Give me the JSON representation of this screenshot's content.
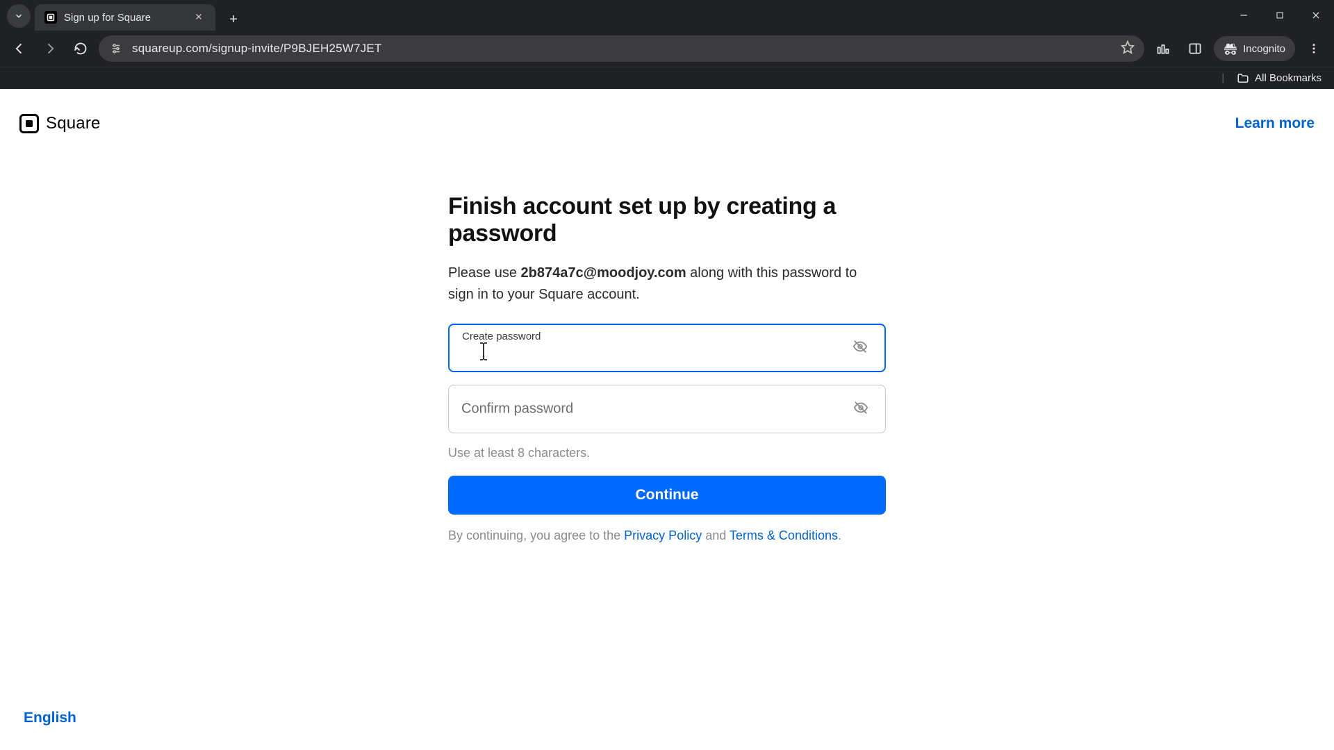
{
  "browser": {
    "tab_title": "Sign up for Square",
    "url": "squareup.com/signup-invite/P9BJEH25W7JET",
    "incognito_label": "Incognito",
    "bookmarks_label": "All Bookmarks"
  },
  "header": {
    "brand": "Square",
    "learn_more": "Learn more"
  },
  "form": {
    "title": "Finish account set up by creating a password",
    "subtitle_pre": "Please use ",
    "email": "2b874a7c@moodjoy.com",
    "subtitle_post": " along with this password to sign in to your Square account.",
    "create_label": "Create password",
    "confirm_label": "Confirm password",
    "hint": "Use at least 8 characters.",
    "continue": "Continue",
    "legal_pre": "By continuing, you agree to the ",
    "privacy": "Privacy Policy",
    "legal_mid": " and ",
    "terms": "Terms & Conditions",
    "legal_post": "."
  },
  "footer": {
    "language": "English"
  }
}
